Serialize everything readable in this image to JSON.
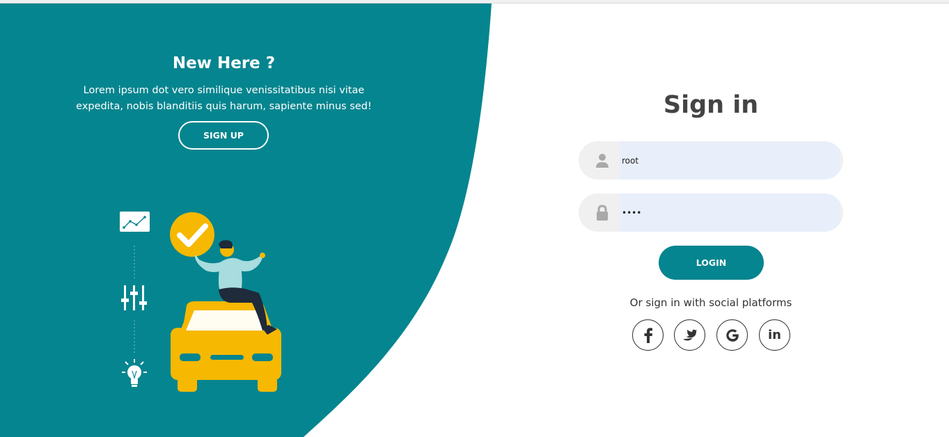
{
  "colors": {
    "primary": "#05858f",
    "car": "#f6b800",
    "field_bg": "#f0f0f0",
    "input_bg": "#e8effa"
  },
  "left": {
    "title": "New Here ?",
    "description_line1": "Lorem ipsum dot vero similique venissitatibus nisi vitae",
    "description_line2": "expedita, nobis blanditiis quis harum, sapiente minus sed!",
    "signup_label": "SIGN UP"
  },
  "signin": {
    "title": "Sign in",
    "username_value": "root",
    "password_value": "••••",
    "username_icon": "user-icon",
    "password_icon": "lock-icon",
    "login_label": "LOGIN",
    "social_text": "Or sign in with social platforms",
    "social": [
      {
        "icon": "facebook-icon"
      },
      {
        "icon": "twitter-icon"
      },
      {
        "icon": "google-icon"
      },
      {
        "icon": "linkedin-icon",
        "text": "in"
      }
    ]
  }
}
